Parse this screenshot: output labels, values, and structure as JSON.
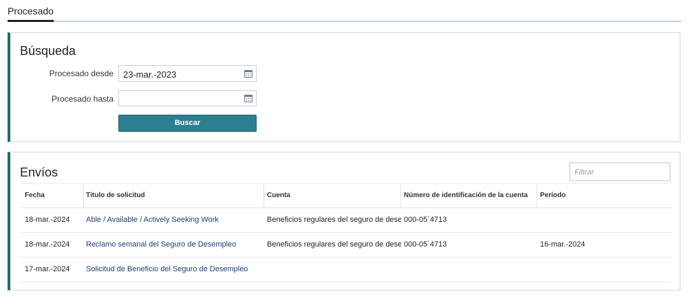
{
  "tabs": [
    {
      "label": "Procesado"
    }
  ],
  "search": {
    "title": "Búsqueda",
    "desde_label": "Procesado desde",
    "desde_value": "23-mar.-2023",
    "hasta_label": "Procesado hasta",
    "hasta_value": "",
    "button_label": "Buscar"
  },
  "envios": {
    "title": "Envíos",
    "filter_placeholder": "Filtrar",
    "columns": [
      "Fecha",
      "Título de solicitud",
      "Cuenta",
      "Número de identificación de la cuenta",
      "Período"
    ],
    "rows": [
      {
        "fecha": "18-mar.-2024",
        "titulo": "Able / Available / Actively Seeking Work",
        "cuenta": "Beneficios regulares del seguro de dese",
        "numero": "000-05´4713",
        "periodo": ""
      },
      {
        "fecha": "18-mar.-2024",
        "titulo": "Reclamo semanal del Seguro de Desempleo",
        "cuenta": "Beneficios regulares del seguro de dese",
        "numero": "000-05´4713",
        "periodo": "16-mar.-2024"
      },
      {
        "fecha": "17-mar.-2024",
        "titulo": "Solicitud de Beneficio del Seguro de Desempleo",
        "cuenta": "",
        "numero": "",
        "periodo": ""
      }
    ]
  },
  "colors": {
    "accent": "#1d6b73",
    "button": "#2b7f8f",
    "tab_line": "#b9d3e8",
    "link": "#1f3f6e"
  },
  "icons": {
    "date_picker": "calendar-icon"
  }
}
